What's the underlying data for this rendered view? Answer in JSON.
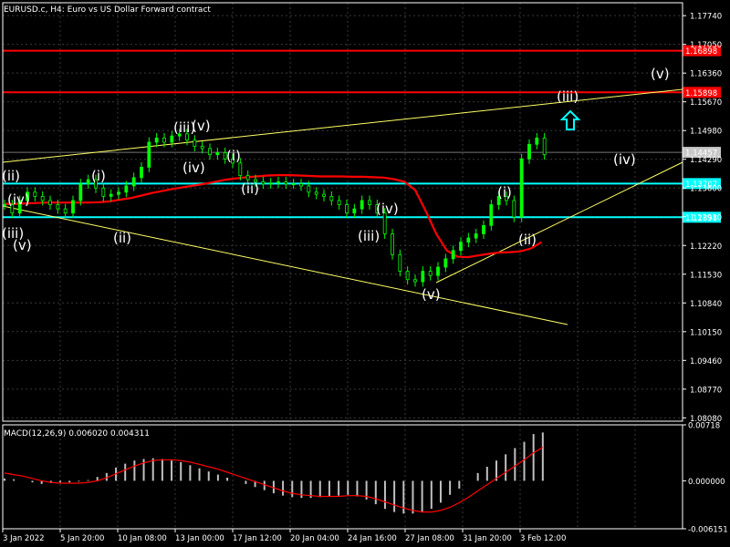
{
  "header": {
    "title": "EURUSD.c, H4:  Euro vs US Dollar Forward contract"
  },
  "colors": {
    "background": "#000000",
    "grid": "#3a3a3a",
    "bull": "#00ff00",
    "red_line": "#ff0000",
    "cyan_line": "#00ffff",
    "yellow_line": "#ffff66",
    "ma": "#ff0000",
    "histogram": "#c0c0c0",
    "signal": "#ff0000",
    "arrow": "#00ffff"
  },
  "chart_data": [
    {
      "type": "candlestick",
      "title": "EURUSD.c, H4:  Euro vs US Dollar Forward contract",
      "ylim": [
        1.08,
        1.1805
      ],
      "y_ticks": [
        "1.17740",
        "1.17050",
        "1.16360",
        "1.15670",
        "1.14980",
        "1.14290",
        "1.13600",
        "1.12910",
        "1.12220",
        "1.11530",
        "1.10840",
        "1.10150",
        "1.09460",
        "1.08770",
        "1.08080"
      ],
      "x_ticks": [
        "3 Jan 2022",
        "5 Jan 20:00",
        "10 Jan 08:00",
        "13 Jan 00:00",
        "17 Jan 12:00",
        "20 Jan 04:00",
        "24 Jan 16:00",
        "27 Jan 08:00",
        "31 Jan 20:00",
        "3 Feb 12:00"
      ],
      "series": [
        {
          "name": "",
          "values": [
            1.132,
            1.13,
            1.133,
            1.135,
            1.134,
            1.133,
            1.132,
            1.131,
            1.13,
            1.133,
            1.137,
            1.138,
            1.136,
            1.134,
            1.1345,
            1.135,
            1.1365,
            1.1385,
            1.141,
            1.147,
            1.148,
            1.147,
            1.1485,
            1.149,
            1.1475,
            1.146,
            1.1455,
            1.144,
            1.1445,
            1.143,
            1.142,
            1.139,
            1.138,
            1.1375,
            1.137,
            1.1372,
            1.1375,
            1.137,
            1.137,
            1.1365,
            1.135,
            1.1345,
            1.134,
            1.133,
            1.132,
            1.13,
            1.131,
            1.133,
            1.132,
            1.13,
            1.125,
            1.12,
            1.116,
            1.114,
            1.1135,
            1.116,
            1.115,
            1.117,
            1.119,
            1.121,
            1.123,
            1.124,
            1.125,
            1.127,
            1.132,
            1.134,
            1.133,
            1.129,
            1.143,
            1.1465,
            1.148,
            1.144
          ]
        }
      ],
      "moving_average": [
        1.1322,
        1.1322,
        1.1323,
        1.1324,
        1.1325,
        1.1325,
        1.1325,
        1.1325,
        1.1325,
        1.1326,
        1.1328,
        1.1332,
        1.1336,
        1.1342,
        1.1348,
        1.1353,
        1.1358,
        1.1362,
        1.1366,
        1.137,
        1.1375,
        1.138,
        1.1383,
        1.1386,
        1.1388,
        1.139,
        1.1391,
        1.1391,
        1.139,
        1.1389,
        1.1388,
        1.1388,
        1.1388,
        1.1387,
        1.1387,
        1.1386,
        1.1385,
        1.1381,
        1.1375,
        1.1355,
        1.1305,
        1.125,
        1.121,
        1.1195,
        1.1194,
        1.1198,
        1.1202,
        1.1205,
        1.1206,
        1.1208,
        1.1215,
        1.123
      ],
      "horizontal_lines": [
        {
          "price": 1.16898,
          "label": "1.16898",
          "color": "#ff0000"
        },
        {
          "price": 1.15898,
          "label": "1.15898",
          "color": "#ff0000"
        },
        {
          "price": 1.13707,
          "label": "1.13707",
          "color": "#00ffff"
        },
        {
          "price": 1.12898,
          "label": "1.12898",
          "color": "#00ffff"
        }
      ],
      "current_price": {
        "price": 1.14457,
        "label": "1.14457"
      },
      "wave_labels": [
        "(ii)",
        "(iv)",
        "(iii)",
        "(v)",
        "(i)",
        "(ii)",
        "(iii)",
        "(v)",
        "(iv)",
        "(i)",
        "(ii)",
        "(iii)",
        "(iv)",
        "(v)",
        "(i)",
        "(ii)",
        "(iii)",
        "(iv)",
        "(v)"
      ],
      "grid": true
    },
    {
      "type": "bar",
      "title": "MACD(12,26,9) 0.006020 0.004311",
      "ylim": [
        -0.00615,
        0.00718
      ],
      "y_ticks": [
        "0.00718",
        "0.000000",
        "-0.006151"
      ],
      "values": [
        0.0003,
        0.0002,
        0.0,
        -0.0002,
        -0.0004,
        -0.0003,
        -0.0002,
        -0.0002,
        -0.0001,
        0.0001,
        0.0005,
        0.001,
        0.0017,
        0.0022,
        0.0026,
        0.0028,
        0.0029,
        0.0028,
        0.0026,
        0.0024,
        0.002,
        0.0016,
        0.0012,
        0.0008,
        0.0004,
        0.0,
        -0.0004,
        -0.0008,
        -0.0012,
        -0.0016,
        -0.0019,
        -0.0021,
        -0.0022,
        -0.0022,
        -0.0021,
        -0.002,
        -0.0019,
        -0.0018,
        -0.002,
        -0.0024,
        -0.003,
        -0.0036,
        -0.004,
        -0.0042,
        -0.0042,
        -0.004,
        -0.0036,
        -0.0028,
        -0.0018,
        -0.001,
        0.0,
        0.001,
        0.0018,
        0.0026,
        0.0034,
        0.0042,
        0.005,
        0.006,
        0.0062
      ],
      "signal": [
        0.001,
        0.0008,
        0.0006,
        0.0003,
        0.0,
        -0.0002,
        -0.0003,
        -0.0003,
        -0.0003,
        -0.0002,
        0.0,
        0.0004,
        0.0009,
        0.0014,
        0.0019,
        0.0023,
        0.0026,
        0.0027,
        0.0027,
        0.0026,
        0.0024,
        0.0021,
        0.0018,
        0.0015,
        0.0011,
        0.0007,
        0.0003,
        -0.0001,
        -0.0005,
        -0.0009,
        -0.0013,
        -0.0016,
        -0.0018,
        -0.0019,
        -0.002,
        -0.002,
        -0.002,
        -0.0019,
        -0.0019,
        -0.002,
        -0.0023,
        -0.0027,
        -0.0031,
        -0.0035,
        -0.0038,
        -0.004,
        -0.004,
        -0.0038,
        -0.0034,
        -0.0028,
        -0.0021,
        -0.0013,
        -0.0005,
        0.0003,
        0.0011,
        0.0019,
        0.0027,
        0.0036,
        0.0043
      ]
    }
  ]
}
